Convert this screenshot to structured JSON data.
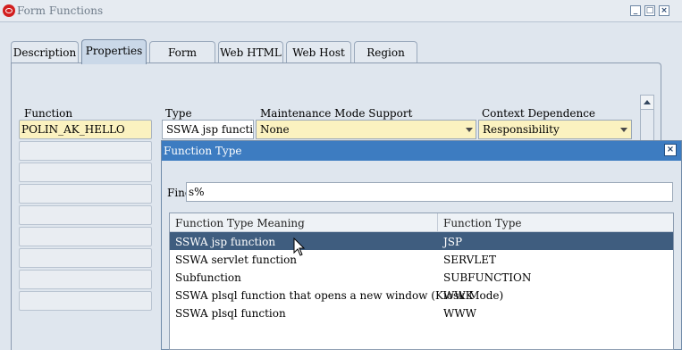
{
  "window": {
    "title": "Form Functions",
    "controls": [
      "minimize",
      "maximize",
      "close"
    ]
  },
  "tabs": [
    {
      "label": "Description",
      "active": false
    },
    {
      "label": "Properties",
      "active": true
    },
    {
      "label": "Form",
      "active": false
    },
    {
      "label": "Web HTML",
      "active": false
    },
    {
      "label": "Web Host",
      "active": false
    },
    {
      "label": "Region",
      "active": false
    }
  ],
  "form": {
    "columns": {
      "function": "Function",
      "type": "Type",
      "maintenance": "Maintenance Mode Support",
      "context": "Context Dependence"
    },
    "row1": {
      "function": "POLIN_AK_HELLO",
      "type": "SSWA jsp function",
      "maintenance": "None",
      "context": "Responsibility"
    }
  },
  "dialog": {
    "title": "Function Type",
    "find_label": "Find",
    "find_value": "s%",
    "columns": {
      "meaning": "Function Type Meaning",
      "type": "Function Type"
    },
    "rows": [
      {
        "meaning": "SSWA jsp function",
        "type": "JSP",
        "selected": true
      },
      {
        "meaning": "SSWA servlet function",
        "type": "SERVLET",
        "selected": false
      },
      {
        "meaning": "Subfunction",
        "type": "SUBFUNCTION",
        "selected": false
      },
      {
        "meaning": "SSWA plsql function that opens a new window (Kiosk Mode)",
        "type": "WWK",
        "selected": false
      },
      {
        "meaning": "SSWA plsql function",
        "type": "WWW",
        "selected": false
      }
    ]
  },
  "colors": {
    "title_bar_blue": "#3d7cc1",
    "selected_row": "#3f5d7f",
    "required_field_yellow": "#fbf2c0"
  }
}
